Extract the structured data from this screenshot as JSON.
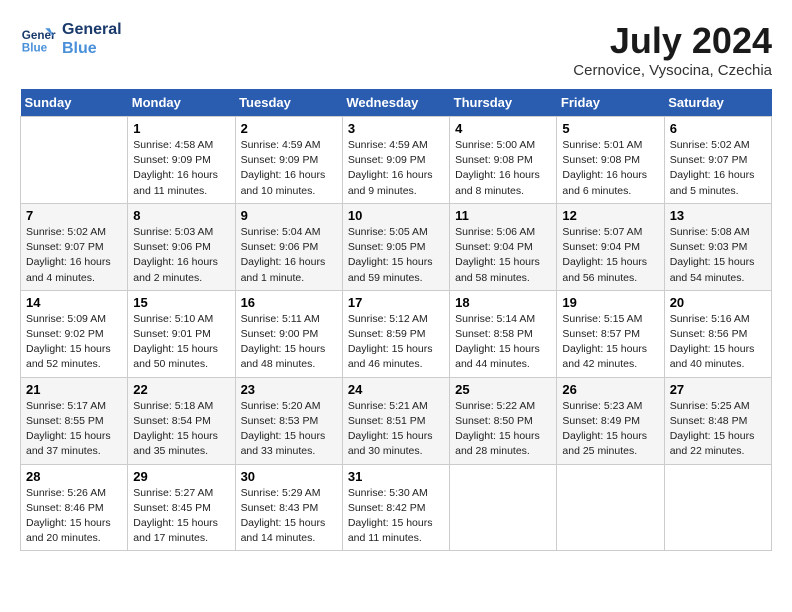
{
  "header": {
    "logo_line1": "General",
    "logo_line2": "Blue",
    "month": "July 2024",
    "location": "Cernovice, Vysocina, Czechia"
  },
  "days_of_week": [
    "Sunday",
    "Monday",
    "Tuesday",
    "Wednesday",
    "Thursday",
    "Friday",
    "Saturday"
  ],
  "weeks": [
    [
      {
        "day": "",
        "info": ""
      },
      {
        "day": "1",
        "info": "Sunrise: 4:58 AM\nSunset: 9:09 PM\nDaylight: 16 hours\nand 11 minutes."
      },
      {
        "day": "2",
        "info": "Sunrise: 4:59 AM\nSunset: 9:09 PM\nDaylight: 16 hours\nand 10 minutes."
      },
      {
        "day": "3",
        "info": "Sunrise: 4:59 AM\nSunset: 9:09 PM\nDaylight: 16 hours\nand 9 minutes."
      },
      {
        "day": "4",
        "info": "Sunrise: 5:00 AM\nSunset: 9:08 PM\nDaylight: 16 hours\nand 8 minutes."
      },
      {
        "day": "5",
        "info": "Sunrise: 5:01 AM\nSunset: 9:08 PM\nDaylight: 16 hours\nand 6 minutes."
      },
      {
        "day": "6",
        "info": "Sunrise: 5:02 AM\nSunset: 9:07 PM\nDaylight: 16 hours\nand 5 minutes."
      }
    ],
    [
      {
        "day": "7",
        "info": "Sunrise: 5:02 AM\nSunset: 9:07 PM\nDaylight: 16 hours\nand 4 minutes."
      },
      {
        "day": "8",
        "info": "Sunrise: 5:03 AM\nSunset: 9:06 PM\nDaylight: 16 hours\nand 2 minutes."
      },
      {
        "day": "9",
        "info": "Sunrise: 5:04 AM\nSunset: 9:06 PM\nDaylight: 16 hours\nand 1 minute."
      },
      {
        "day": "10",
        "info": "Sunrise: 5:05 AM\nSunset: 9:05 PM\nDaylight: 15 hours\nand 59 minutes."
      },
      {
        "day": "11",
        "info": "Sunrise: 5:06 AM\nSunset: 9:04 PM\nDaylight: 15 hours\nand 58 minutes."
      },
      {
        "day": "12",
        "info": "Sunrise: 5:07 AM\nSunset: 9:04 PM\nDaylight: 15 hours\nand 56 minutes."
      },
      {
        "day": "13",
        "info": "Sunrise: 5:08 AM\nSunset: 9:03 PM\nDaylight: 15 hours\nand 54 minutes."
      }
    ],
    [
      {
        "day": "14",
        "info": "Sunrise: 5:09 AM\nSunset: 9:02 PM\nDaylight: 15 hours\nand 52 minutes."
      },
      {
        "day": "15",
        "info": "Sunrise: 5:10 AM\nSunset: 9:01 PM\nDaylight: 15 hours\nand 50 minutes."
      },
      {
        "day": "16",
        "info": "Sunrise: 5:11 AM\nSunset: 9:00 PM\nDaylight: 15 hours\nand 48 minutes."
      },
      {
        "day": "17",
        "info": "Sunrise: 5:12 AM\nSunset: 8:59 PM\nDaylight: 15 hours\nand 46 minutes."
      },
      {
        "day": "18",
        "info": "Sunrise: 5:14 AM\nSunset: 8:58 PM\nDaylight: 15 hours\nand 44 minutes."
      },
      {
        "day": "19",
        "info": "Sunrise: 5:15 AM\nSunset: 8:57 PM\nDaylight: 15 hours\nand 42 minutes."
      },
      {
        "day": "20",
        "info": "Sunrise: 5:16 AM\nSunset: 8:56 PM\nDaylight: 15 hours\nand 40 minutes."
      }
    ],
    [
      {
        "day": "21",
        "info": "Sunrise: 5:17 AM\nSunset: 8:55 PM\nDaylight: 15 hours\nand 37 minutes."
      },
      {
        "day": "22",
        "info": "Sunrise: 5:18 AM\nSunset: 8:54 PM\nDaylight: 15 hours\nand 35 minutes."
      },
      {
        "day": "23",
        "info": "Sunrise: 5:20 AM\nSunset: 8:53 PM\nDaylight: 15 hours\nand 33 minutes."
      },
      {
        "day": "24",
        "info": "Sunrise: 5:21 AM\nSunset: 8:51 PM\nDaylight: 15 hours\nand 30 minutes."
      },
      {
        "day": "25",
        "info": "Sunrise: 5:22 AM\nSunset: 8:50 PM\nDaylight: 15 hours\nand 28 minutes."
      },
      {
        "day": "26",
        "info": "Sunrise: 5:23 AM\nSunset: 8:49 PM\nDaylight: 15 hours\nand 25 minutes."
      },
      {
        "day": "27",
        "info": "Sunrise: 5:25 AM\nSunset: 8:48 PM\nDaylight: 15 hours\nand 22 minutes."
      }
    ],
    [
      {
        "day": "28",
        "info": "Sunrise: 5:26 AM\nSunset: 8:46 PM\nDaylight: 15 hours\nand 20 minutes."
      },
      {
        "day": "29",
        "info": "Sunrise: 5:27 AM\nSunset: 8:45 PM\nDaylight: 15 hours\nand 17 minutes."
      },
      {
        "day": "30",
        "info": "Sunrise: 5:29 AM\nSunset: 8:43 PM\nDaylight: 15 hours\nand 14 minutes."
      },
      {
        "day": "31",
        "info": "Sunrise: 5:30 AM\nSunset: 8:42 PM\nDaylight: 15 hours\nand 11 minutes."
      },
      {
        "day": "",
        "info": ""
      },
      {
        "day": "",
        "info": ""
      },
      {
        "day": "",
        "info": ""
      }
    ]
  ]
}
